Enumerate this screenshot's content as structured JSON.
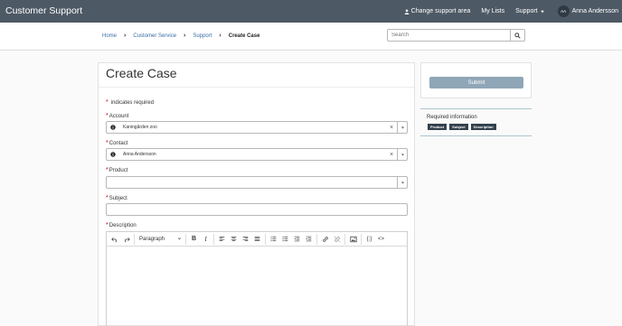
{
  "header": {
    "brand": "Customer Support",
    "change_support_area": "Change support area",
    "my_lists": "My Lists",
    "support_menu": "Support",
    "user_initials": "AA",
    "user_name": "Anna Andersson"
  },
  "breadcrumb": {
    "home": "Home",
    "customer_service": "Customer Service",
    "support": "Support",
    "current": "Create Case"
  },
  "search": {
    "placeholder": "Search"
  },
  "form": {
    "title": "Create Case",
    "required_note": "indicates required",
    "account_label": "Account",
    "account_value": "Kaningården zoo",
    "contact_label": "Contact",
    "contact_value": "Anna Andersson",
    "product_label": "Product",
    "subject_label": "Subject",
    "description_label": "Description",
    "paragraph_format": "Paragraph"
  },
  "side": {
    "submit_label": "Submit",
    "required_info_title": "Required information",
    "required_chips": [
      "Product",
      "Subject",
      "Description"
    ]
  },
  "colors": {
    "topbar": "#4d5965",
    "link": "#3a6ea5",
    "submit": "#8fa6b6",
    "chip": "#32404c",
    "required_star": "#cc0000"
  }
}
